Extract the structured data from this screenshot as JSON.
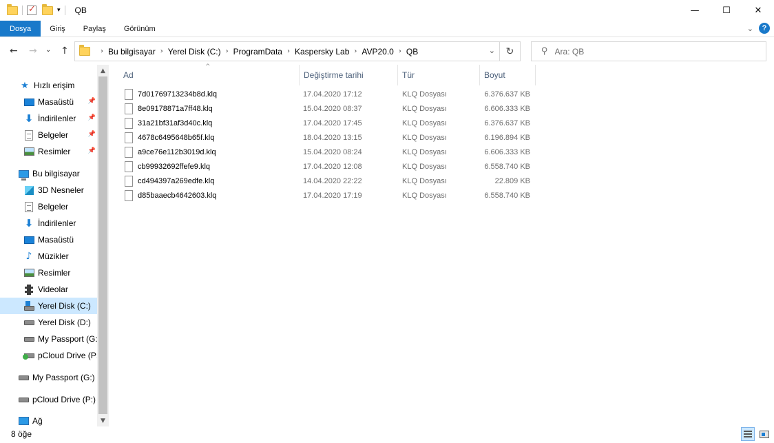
{
  "window": {
    "title": "QB",
    "minimize_glyph": "—",
    "maximize_glyph": "☐",
    "close_glyph": "✕"
  },
  "ribbon": {
    "tabs": [
      "Dosya",
      "Giriş",
      "Paylaş",
      "Görünüm"
    ],
    "accent_color": "#1979ca",
    "help_glyph": "?"
  },
  "navigation": {
    "back_glyph": "←",
    "forward_glyph": "→",
    "dropdown_glyph": "⌄",
    "up_glyph": "↑"
  },
  "address": {
    "crumbs": [
      "Bu bilgisayar",
      "Yerel Disk (C:)",
      "ProgramData",
      "Kaspersky Lab",
      "AVP20.0",
      "QB"
    ],
    "separator_glyph": "›",
    "dropdown_glyph": "⌄",
    "refresh_glyph": "↻"
  },
  "search": {
    "placeholder": "Ara: QB",
    "icon": "search-icon"
  },
  "sidebar": {
    "items": [
      {
        "label": "Hızlı erişim",
        "icon": "star-icon",
        "pinned": false
      },
      {
        "label": "Masaüstü",
        "icon": "desktop-icon",
        "pinned": true
      },
      {
        "label": "İndirilenler",
        "icon": "downloads-icon",
        "pinned": true
      },
      {
        "label": "Belgeler",
        "icon": "documents-icon",
        "pinned": true
      },
      {
        "label": "Resimler",
        "icon": "pictures-icon",
        "pinned": true
      },
      {
        "label": "Bu bilgisayar",
        "icon": "this-pc-icon",
        "pinned": false
      },
      {
        "label": "3D Nesneler",
        "icon": "3d-objects-icon",
        "pinned": false
      },
      {
        "label": "Belgeler",
        "icon": "documents-icon",
        "pinned": false
      },
      {
        "label": "İndirilenler",
        "icon": "downloads-icon",
        "pinned": false
      },
      {
        "label": "Masaüstü",
        "icon": "desktop-icon",
        "pinned": false
      },
      {
        "label": "Müzikler",
        "icon": "music-icon",
        "pinned": false
      },
      {
        "label": "Resimler",
        "icon": "pictures-icon",
        "pinned": false
      },
      {
        "label": "Videolar",
        "icon": "videos-icon",
        "pinned": false
      },
      {
        "label": "Yerel Disk (C:)",
        "icon": "local-disk-icon",
        "pinned": false,
        "selected": true
      },
      {
        "label": "Yerel Disk (D:)",
        "icon": "drive-icon",
        "pinned": false
      },
      {
        "label": "My Passport (G:)",
        "icon": "drive-icon",
        "pinned": false
      },
      {
        "label": "pCloud Drive (P:)",
        "icon": "cloud-drive-icon",
        "pinned": false
      },
      {
        "label": "My Passport (G:)",
        "icon": "drive-icon",
        "pinned": false
      },
      {
        "label": "pCloud Drive (P:)",
        "icon": "drive-icon",
        "pinned": false
      },
      {
        "label": "Ağ",
        "icon": "network-icon",
        "pinned": false
      }
    ],
    "pin_glyph": "📌",
    "selected_color": "#cce8ff"
  },
  "files": {
    "columns": [
      "Ad",
      "Değiştirme tarihi",
      "Tür",
      "Boyut"
    ],
    "sort_glyph": "^",
    "rows": [
      {
        "name": "7d01769713234b8d.klq",
        "date": "17.04.2020 17:12",
        "type": "KLQ Dosyası",
        "size": "6.376.637 KB"
      },
      {
        "name": "8e09178871a7ff48.klq",
        "date": "15.04.2020 08:37",
        "type": "KLQ Dosyası",
        "size": "6.606.333 KB"
      },
      {
        "name": "31a21bf31af3d40c.klq",
        "date": "17.04.2020 17:45",
        "type": "KLQ Dosyası",
        "size": "6.376.637 KB"
      },
      {
        "name": "4678c6495648b65f.klq",
        "date": "18.04.2020 13:15",
        "type": "KLQ Dosyası",
        "size": "6.196.894 KB"
      },
      {
        "name": "a9ce76e112b3019d.klq",
        "date": "15.04.2020 08:24",
        "type": "KLQ Dosyası",
        "size": "6.606.333 KB"
      },
      {
        "name": "cb99932692ffefe9.klq",
        "date": "17.04.2020 12:08",
        "type": "KLQ Dosyası",
        "size": "6.558.740 KB"
      },
      {
        "name": "cd494397a269edfe.klq",
        "date": "14.04.2020 22:22",
        "type": "KLQ Dosyası",
        "size": "22.809 KB"
      },
      {
        "name": "d85baaecb4642603.klq",
        "date": "17.04.2020 17:19",
        "type": "KLQ Dosyası",
        "size": "6.558.740 KB"
      }
    ]
  },
  "statusbar": {
    "item_count": "8 öğe",
    "view_modes": [
      "details-view-icon",
      "large-icons-view-icon"
    ]
  }
}
